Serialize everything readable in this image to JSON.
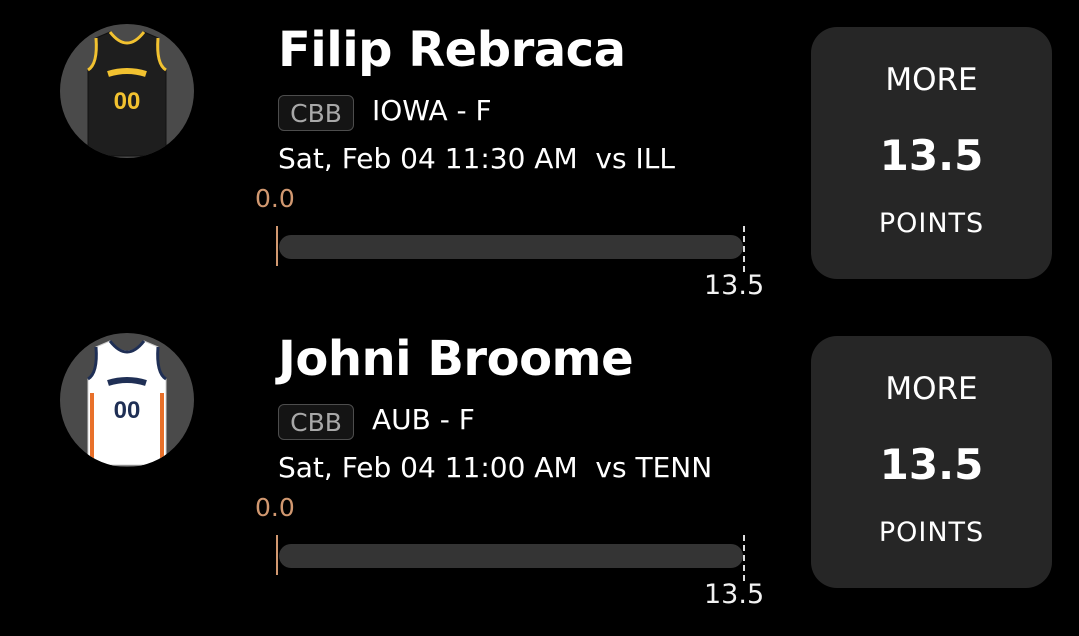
{
  "players": [
    {
      "name": "Filip Rebraca",
      "league": "CBB",
      "team_position": "IOWA - F",
      "game_time": "Sat, Feb 04 11:30 AM  vs ILL",
      "current_value": "0.0",
      "line_value": "13.5",
      "progress_fraction": 0.0,
      "pick": {
        "direction": "MORE",
        "value": "13.5",
        "stat": "POINTS"
      },
      "jersey": {
        "body": "#1e1e1e",
        "trim": "#f2c230",
        "number": "00",
        "number_color": "#f2c230"
      }
    },
    {
      "name": "Johni Broome",
      "league": "CBB",
      "team_position": "AUB - F",
      "game_time": "Sat, Feb 04 11:00 AM  vs TENN",
      "current_value": "0.0",
      "line_value": "13.5",
      "progress_fraction": 0.0,
      "pick": {
        "direction": "MORE",
        "value": "13.5",
        "stat": "POINTS"
      },
      "jersey": {
        "body": "#ffffff",
        "trim": "#1f2f55",
        "accent": "#e8702a",
        "number": "00",
        "number_color": "#1f2f55"
      }
    }
  ]
}
